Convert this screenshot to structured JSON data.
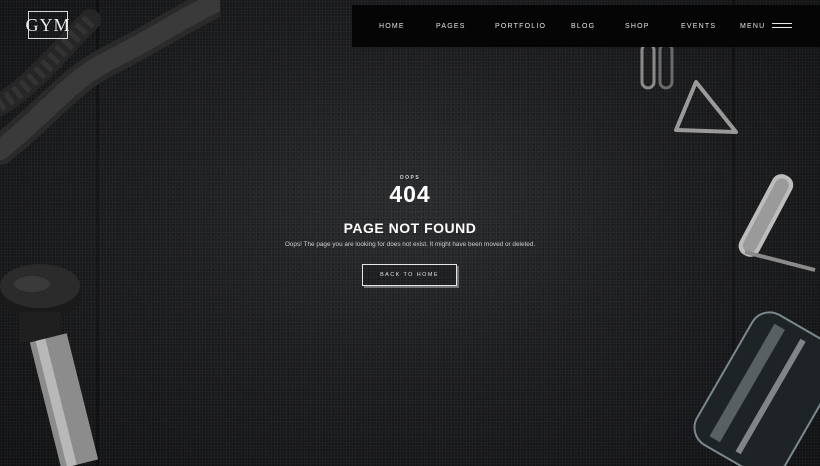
{
  "logo": {
    "text": "GYM"
  },
  "nav": {
    "items": [
      "HOME",
      "PAGES",
      "PORTFOLIO",
      "BLOG",
      "SHOP",
      "EVENTS"
    ],
    "menu_label": "MENU"
  },
  "error": {
    "eyebrow": "OOPS",
    "code": "404",
    "title": "PAGE NOT FOUND",
    "message": "Oops! The page you are looking for does not exist. It might have been moved or deleted.",
    "button_label": "BACK TO HOME"
  }
}
